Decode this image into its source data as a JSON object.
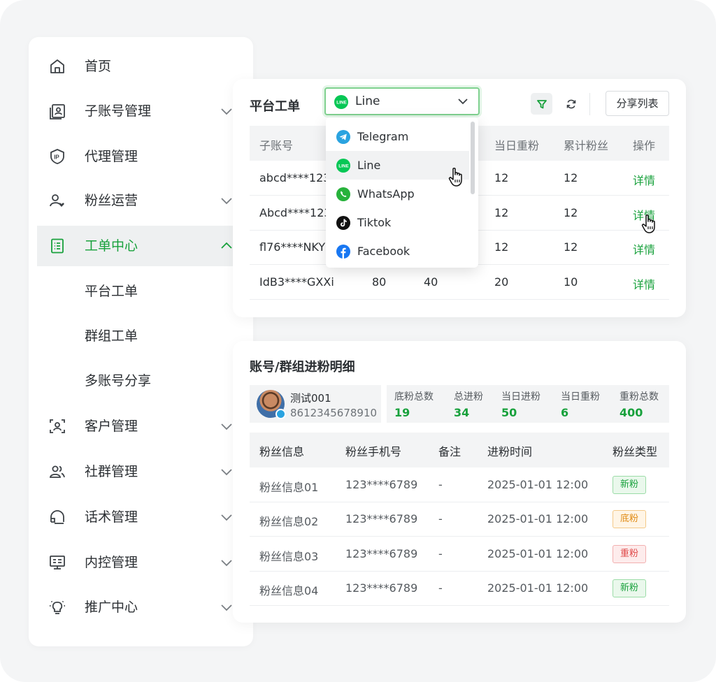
{
  "sidebar": {
    "items": [
      {
        "label": "首页",
        "icon": "home-icon"
      },
      {
        "label": "子账号管理",
        "icon": "contact-card-icon"
      },
      {
        "label": "代理管理",
        "icon": "ip-shield-icon"
      },
      {
        "label": "粉丝运营",
        "icon": "user-heart-icon"
      },
      {
        "label": "工单中心",
        "icon": "document-list-icon"
      },
      {
        "label": "客户管理",
        "icon": "customer-scan-icon"
      },
      {
        "label": "社群管理",
        "icon": "group-users-icon"
      },
      {
        "label": "话术管理",
        "icon": "headset-icon"
      },
      {
        "label": "内控管理",
        "icon": "monitor-icon"
      },
      {
        "label": "推广中心",
        "icon": "lightbulb-icon"
      }
    ],
    "sub_items": [
      "平台工单",
      "群组工单",
      "多账号分享"
    ],
    "active_color": "#18a13c"
  },
  "platform_card": {
    "title": "平台工单",
    "selected_platform": "Line",
    "share_label": "分享列表",
    "columns": [
      "子账号",
      "当日重粉",
      "累计粉丝",
      "操作"
    ],
    "rows": [
      {
        "account": "abcd****123",
        "today_dup": "12",
        "total": "12",
        "action": "详情"
      },
      {
        "account": "Abcd****123",
        "today_dup": "12",
        "total": "12",
        "action": "详情"
      },
      {
        "account": "fl76****NKY",
        "today_dup": "12",
        "total": "12",
        "action": "详情"
      },
      {
        "account": "IdB3****GXXi",
        "c2": "80",
        "c3": "40",
        "today_dup": "20",
        "total": "10",
        "action": "详情"
      }
    ],
    "dropdown_options": [
      "Telegram",
      "Line",
      "WhatsApp",
      "Tiktok",
      "Facebook"
    ]
  },
  "detail_card": {
    "title": "账号/群组进粉明细",
    "profile": {
      "name": "测试001",
      "phone": "8612345678910"
    },
    "stats": [
      {
        "label": "底粉总数",
        "value": "19"
      },
      {
        "label": "总进粉",
        "value": "34"
      },
      {
        "label": "当日进粉",
        "value": "50"
      },
      {
        "label": "当日重粉",
        "value": "6"
      },
      {
        "label": "重粉总数",
        "value": "400"
      }
    ],
    "columns": [
      "粉丝信息",
      "粉丝手机号",
      "备注",
      "进粉时间",
      "粉丝类型"
    ],
    "rows": [
      {
        "info": "粉丝信息01",
        "phone": "123****6789",
        "note": "-",
        "time": "2025-01-01 12:00",
        "type": "新粉"
      },
      {
        "info": "粉丝信息02",
        "phone": "123****6789",
        "note": "-",
        "time": "2025-01-01 12:00",
        "type": "底粉"
      },
      {
        "info": "粉丝信息03",
        "phone": "123****6789",
        "note": "-",
        "time": "2025-01-01 12:00",
        "type": "重粉"
      },
      {
        "info": "粉丝信息04",
        "phone": "123****6789",
        "note": "-",
        "time": "2025-01-01 12:00",
        "type": "新粉"
      }
    ]
  }
}
